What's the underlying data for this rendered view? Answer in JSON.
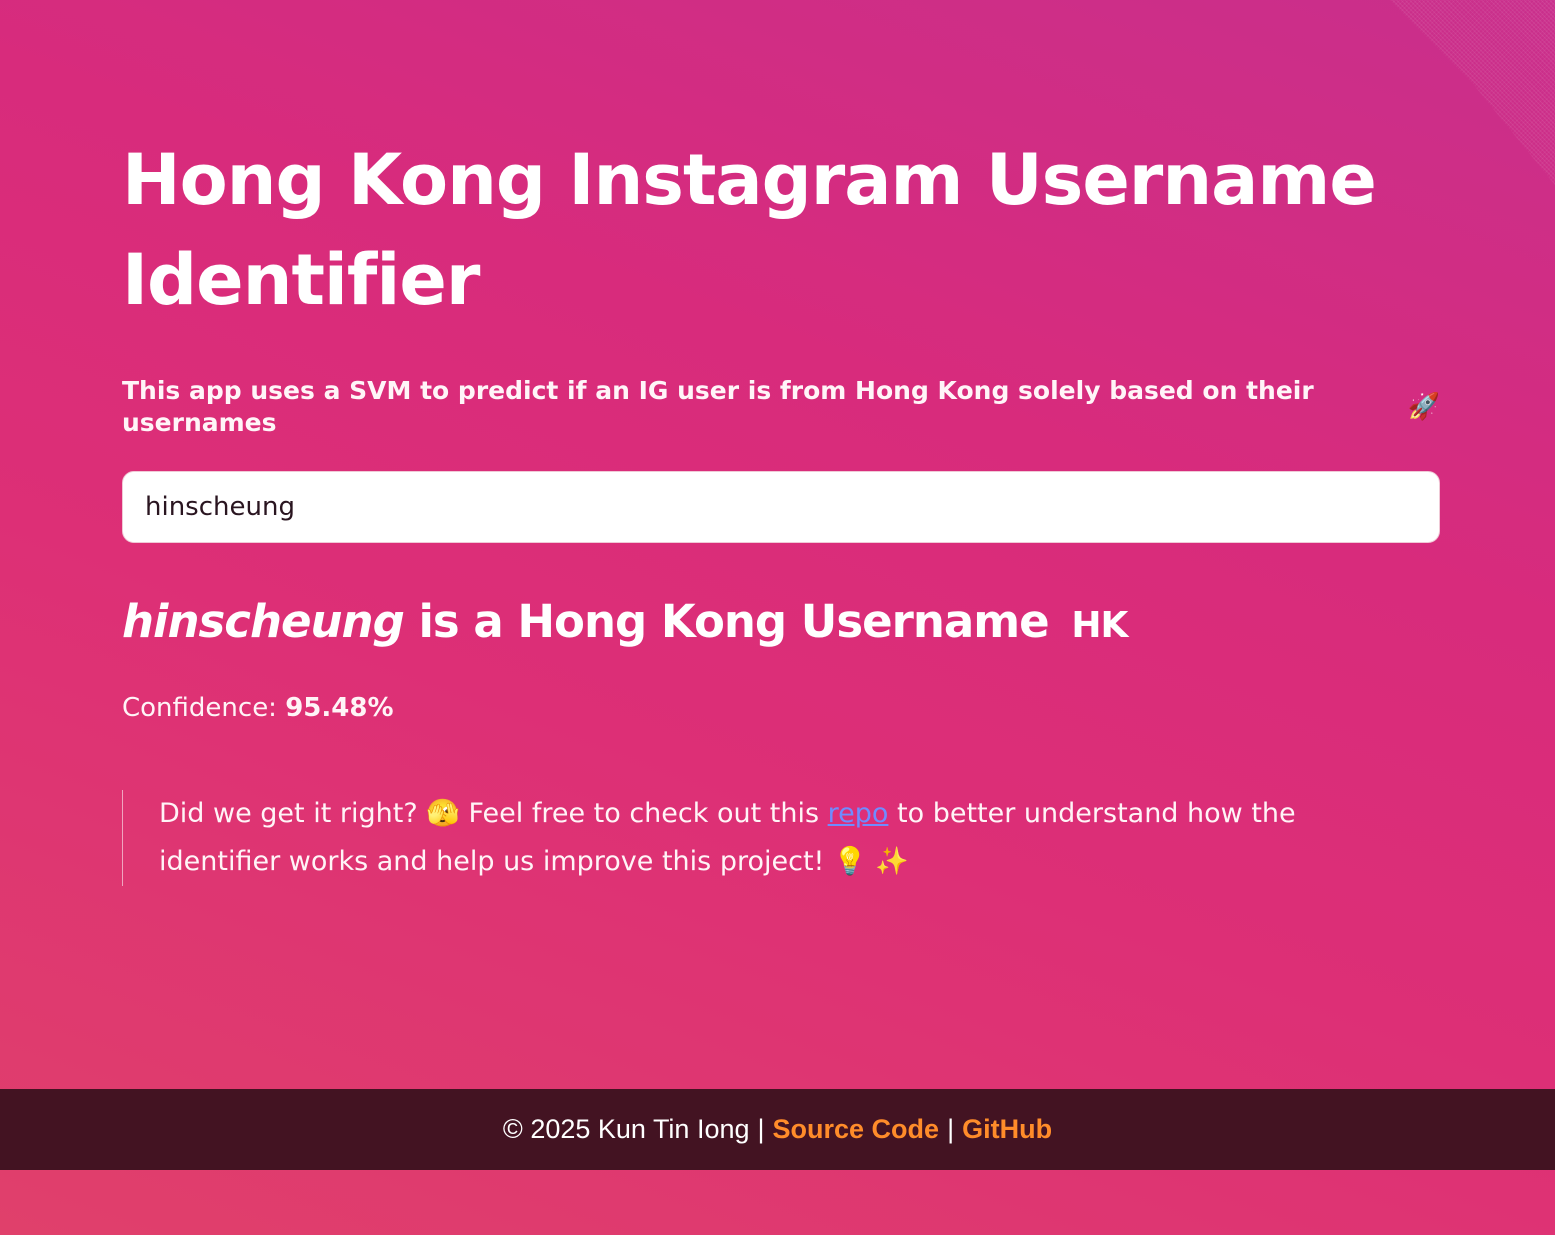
{
  "header": {
    "title": "Hong Kong Instagram Username Identifier",
    "subtitle": "This app uses a SVM to predict if an IG user is from Hong Kong solely based on their usernames",
    "subtitle_icon": "🚀"
  },
  "search": {
    "value": "hinscheung"
  },
  "result": {
    "username": "hinscheung",
    "text": "is a Hong Kong Username",
    "flag": "HK",
    "confidence_label": "Confidence:",
    "confidence_value": "95.48%"
  },
  "feedback": {
    "text_before": "Did we get it right?",
    "emoji_1": "🫣",
    "text_mid": "Feel free to check out this",
    "link_label": "repo",
    "text_after": "to better understand how the identifier works and help us improve this project!",
    "emoji_2": "💡",
    "emoji_3": "✨"
  },
  "footer": {
    "copyright": "© 2025 Kun Tin Iong",
    "separator": "|",
    "source_label": "Source Code",
    "github_label": "GitHub"
  },
  "colors": {
    "link": "#6f8cff",
    "footer_bg": "#431322",
    "footer_link": "#ff8c2a"
  }
}
